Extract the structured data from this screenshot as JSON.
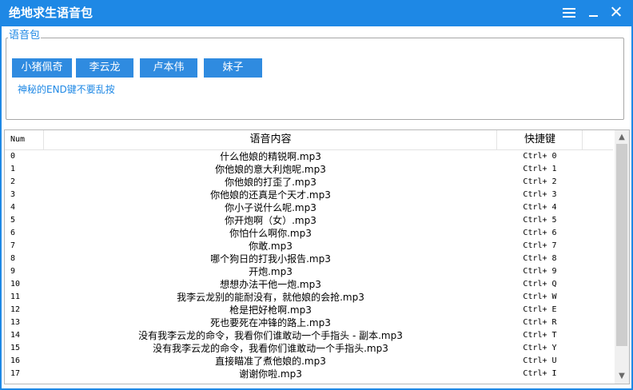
{
  "window": {
    "title": "绝地求生语音包"
  },
  "group": {
    "title": "语音包",
    "buttons": [
      "小猪佩奇",
      "李云龙",
      "卢本伟",
      "妹子"
    ],
    "hint": "神秘的END键不要乱按"
  },
  "table": {
    "columns": {
      "num": "Num",
      "name": "语音内容",
      "key": "快捷键"
    },
    "rows": [
      {
        "num": "0",
        "name": "什么他娘的精锐啊.mp3",
        "key": "Ctrl+ 0"
      },
      {
        "num": "1",
        "name": "你他娘的意大利炮呢.mp3",
        "key": "Ctrl+ 1"
      },
      {
        "num": "2",
        "name": "你他娘的打歪了.mp3",
        "key": "Ctrl+ 2"
      },
      {
        "num": "3",
        "name": "你他娘的还真是个天才.mp3",
        "key": "Ctrl+ 3"
      },
      {
        "num": "4",
        "name": "你小子说什么呢.mp3",
        "key": "Ctrl+ 4"
      },
      {
        "num": "5",
        "name": "你开炮啊（女）.mp3",
        "key": "Ctrl+ 5"
      },
      {
        "num": "6",
        "name": "你怕什么啊你.mp3",
        "key": "Ctrl+ 6"
      },
      {
        "num": "7",
        "name": "你敢.mp3",
        "key": "Ctrl+ 7"
      },
      {
        "num": "8",
        "name": "哪个狗日的打我小报告.mp3",
        "key": "Ctrl+ 8"
      },
      {
        "num": "9",
        "name": "开炮.mp3",
        "key": "Ctrl+ 9"
      },
      {
        "num": "10",
        "name": "想想办法干他一炮.mp3",
        "key": "Ctrl+ Q"
      },
      {
        "num": "11",
        "name": "我李云龙别的能耐没有，就他娘的会抢.mp3",
        "key": "Ctrl+ W"
      },
      {
        "num": "12",
        "name": "枪是把好枪啊.mp3",
        "key": "Ctrl+ E"
      },
      {
        "num": "13",
        "name": "死也要死在冲锋的路上.mp3",
        "key": "Ctrl+ R"
      },
      {
        "num": "14",
        "name": "没有我李云龙的命令，我看你们谁敢动一个手指头 - 副本.mp3",
        "key": "Ctrl+ T"
      },
      {
        "num": "15",
        "name": "没有我李云龙的命令，我看你们谁敢动一个手指头.mp3",
        "key": "Ctrl+ Y"
      },
      {
        "num": "16",
        "name": "直接瞄准了煮他娘的.mp3",
        "key": "Ctrl+ U"
      },
      {
        "num": "17",
        "name": "谢谢你啦.mp3",
        "key": "Ctrl+ I"
      }
    ]
  },
  "icons": {
    "menu": "hamburger-menu-icon",
    "minimize": "minimize-icon",
    "close": "close-icon",
    "scroll_up": "scroll-up-arrow-icon",
    "scroll_down": "scroll-down-arrow-icon"
  },
  "colors": {
    "titlebar": "#1e88e5",
    "button": "#2f8be0",
    "hint": "#1e88e5"
  }
}
